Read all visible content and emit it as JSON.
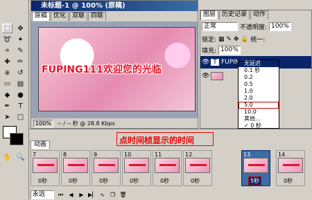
{
  "toolbox": {
    "tools": [
      "marquee",
      "move",
      "lasso",
      "magic-wand",
      "crop",
      "slice",
      "healing",
      "brush",
      "stamp",
      "history-brush",
      "eraser",
      "gradient",
      "blur",
      "dodge",
      "pen",
      "type",
      "path-select",
      "shape",
      "notes",
      "eyedropper",
      "hand",
      "zoom"
    ]
  },
  "document": {
    "title": "未标题-1 @ 100% (原稿)",
    "tabs": [
      "原稿",
      "优化",
      "双联",
      "四联"
    ],
    "active_tab": 0,
    "banner_text": "FUPING111欢迎您的光临",
    "zoom": "100%",
    "status": "-- / -- 秒 @ 28.8 Kbps"
  },
  "layers_panel": {
    "tabs": [
      "图层",
      "历史记录",
      "动作"
    ],
    "blend_mode": "正常",
    "opacity_label": "不透明度:",
    "opacity_value": "100%",
    "lock_label": "锁定:",
    "unify_label": "统一:",
    "fill_label": "填充:",
    "fill_value": "100%",
    "layers": [
      {
        "name": "FUPING111...",
        "type": "text",
        "selected": true
      },
      {
        "name": "",
        "type": "image",
        "selected": false
      }
    ]
  },
  "delay_menu": {
    "options": [
      "无延迟",
      "0.1 秒",
      "0.2",
      "0.5",
      "1.0",
      "2.0",
      "5.0",
      "10.0",
      "其他...",
      "✓ 0 秒"
    ],
    "highlighted": "无延迟",
    "boxed": "5.0"
  },
  "animation_panel": {
    "tab": "动画",
    "loop": "永远",
    "frames": [
      {
        "num": "7",
        "delay": "0秒"
      },
      {
        "num": "8",
        "delay": "0秒"
      },
      {
        "num": "9",
        "delay": "0秒"
      },
      {
        "num": "10",
        "delay": "0秒"
      },
      {
        "num": "11",
        "delay": "0秒"
      },
      {
        "num": "12",
        "delay": "0秒"
      },
      {
        "num": "13",
        "delay": "5秒",
        "selected": true
      },
      {
        "num": "14",
        "delay": "0秒"
      }
    ]
  },
  "annotation": "点时间桢显示的时间"
}
